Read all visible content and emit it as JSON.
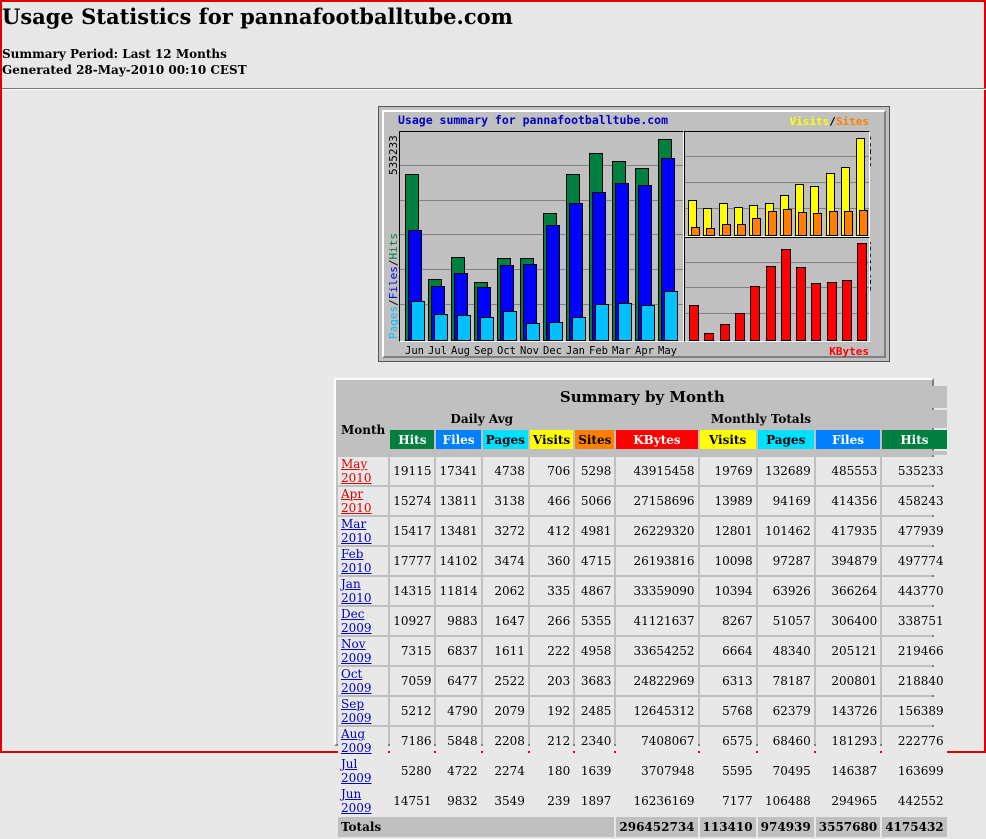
{
  "page": {
    "title": "Usage Statistics for pannafootballtube.com",
    "summary_period": "Summary Period: Last 12 Months",
    "generated": "Generated 28-May-2010 00:10 CEST"
  },
  "graph": {
    "title": "Usage summary for pannafootballtube.com",
    "legend_visits": "Visits",
    "legend_slash": "/",
    "legend_sites": "Sites",
    "legend_kbytes": "KBytes",
    "left_axis_pages": "Pages",
    "left_axis_files": "Files",
    "left_axis_hits": "Hits",
    "left_max": "535233",
    "right_top_max": "19769",
    "right_bottom_max": "43915458",
    "months": [
      "Jun",
      "Jul",
      "Aug",
      "Sep",
      "Oct",
      "Nov",
      "Dec",
      "Jan",
      "Feb",
      "Mar",
      "Apr",
      "May"
    ],
    "colors": {
      "hits": "#008040",
      "files": "#0000ff",
      "pages": "#00c0ff",
      "visits": "#ffff00",
      "sites": "#ff8000",
      "kbytes": "#ff0000"
    }
  },
  "table": {
    "caption": "Summary by Month",
    "month_header": "Month",
    "daily_avg": "Daily Avg",
    "monthly_totals": "Monthly Totals",
    "sub_daily": [
      "Hits",
      "Files",
      "Pages",
      "Visits"
    ],
    "sub_monthly": [
      "Sites",
      "KBytes",
      "Visits",
      "Pages",
      "Files",
      "Hits"
    ],
    "rows": [
      {
        "month": "May 2010",
        "hits_d": "19115",
        "files_d": "17341",
        "pages_d": "4738",
        "visits_d": "706",
        "sites": "5298",
        "kbytes": "43915458",
        "visits": "19769",
        "pages": "132689",
        "files": "485553",
        "hits": "535233"
      },
      {
        "month": "Apr 2010",
        "hits_d": "15274",
        "files_d": "13811",
        "pages_d": "3138",
        "visits_d": "466",
        "sites": "5066",
        "kbytes": "27158696",
        "visits": "13989",
        "pages": "94169",
        "files": "414356",
        "hits": "458243"
      },
      {
        "month": "Mar 2010",
        "hits_d": "15417",
        "files_d": "13481",
        "pages_d": "3272",
        "visits_d": "412",
        "sites": "4981",
        "kbytes": "26229320",
        "visits": "12801",
        "pages": "101462",
        "files": "417935",
        "hits": "477939"
      },
      {
        "month": "Feb 2010",
        "hits_d": "17777",
        "files_d": "14102",
        "pages_d": "3474",
        "visits_d": "360",
        "sites": "4715",
        "kbytes": "26193816",
        "visits": "10098",
        "pages": "97287",
        "files": "394879",
        "hits": "497774"
      },
      {
        "month": "Jan 2010",
        "hits_d": "14315",
        "files_d": "11814",
        "pages_d": "2062",
        "visits_d": "335",
        "sites": "4867",
        "kbytes": "33359090",
        "visits": "10394",
        "pages": "63926",
        "files": "366264",
        "hits": "443770"
      },
      {
        "month": "Dec 2009",
        "hits_d": "10927",
        "files_d": "9883",
        "pages_d": "1647",
        "visits_d": "266",
        "sites": "5355",
        "kbytes": "41121637",
        "visits": "8267",
        "pages": "51057",
        "files": "306400",
        "hits": "338751"
      },
      {
        "month": "Nov 2009",
        "hits_d": "7315",
        "files_d": "6837",
        "pages_d": "1611",
        "visits_d": "222",
        "sites": "4958",
        "kbytes": "33654252",
        "visits": "6664",
        "pages": "48340",
        "files": "205121",
        "hits": "219466"
      },
      {
        "month": "Oct 2009",
        "hits_d": "7059",
        "files_d": "6477",
        "pages_d": "2522",
        "visits_d": "203",
        "sites": "3683",
        "kbytes": "24822969",
        "visits": "6313",
        "pages": "78187",
        "files": "200801",
        "hits": "218840"
      },
      {
        "month": "Sep 2009",
        "hits_d": "5212",
        "files_d": "4790",
        "pages_d": "2079",
        "visits_d": "192",
        "sites": "2485",
        "kbytes": "12645312",
        "visits": "5768",
        "pages": "62379",
        "files": "143726",
        "hits": "156389"
      },
      {
        "month": "Aug 2009",
        "hits_d": "7186",
        "files_d": "5848",
        "pages_d": "2208",
        "visits_d": "212",
        "sites": "2340",
        "kbytes": "7408067",
        "visits": "6575",
        "pages": "68460",
        "files": "181293",
        "hits": "222776"
      },
      {
        "month": "Jul 2009",
        "hits_d": "5280",
        "files_d": "4722",
        "pages_d": "2274",
        "visits_d": "180",
        "sites": "1639",
        "kbytes": "3707948",
        "visits": "5595",
        "pages": "70495",
        "files": "146387",
        "hits": "163699"
      },
      {
        "month": "Jun 2009",
        "hits_d": "14751",
        "files_d": "9832",
        "pages_d": "3549",
        "visits_d": "239",
        "sites": "1897",
        "kbytes": "16236169",
        "visits": "7177",
        "pages": "106488",
        "files": "294965",
        "hits": "442552"
      }
    ],
    "totals": {
      "label": "Totals",
      "kbytes": "296452734",
      "visits": "113410",
      "pages": "974939",
      "files": "3557680",
      "hits": "4175432"
    }
  },
  "chart_data": {
    "type": "bar",
    "title": "Usage summary for pannafootballtube.com",
    "categories": [
      "Jun",
      "Jul",
      "Aug",
      "Sep",
      "Oct",
      "Nov",
      "Dec",
      "Jan",
      "Feb",
      "Mar",
      "Apr",
      "May"
    ],
    "series": [
      {
        "name": "Hits",
        "values": [
          442552,
          163699,
          222776,
          156389,
          218840,
          219466,
          338751,
          443770,
          497774,
          477939,
          458243,
          535233
        ]
      },
      {
        "name": "Files",
        "values": [
          294965,
          146387,
          181293,
          143726,
          200801,
          205121,
          306400,
          366264,
          394879,
          417935,
          414356,
          485553
        ]
      },
      {
        "name": "Pages",
        "values": [
          106488,
          70495,
          68460,
          62379,
          78187,
          48340,
          51057,
          63926,
          97287,
          101462,
          94169,
          132689
        ]
      },
      {
        "name": "Visits",
        "values": [
          7177,
          5595,
          6575,
          5768,
          6313,
          6664,
          8267,
          10394,
          10098,
          12801,
          13989,
          19769
        ]
      },
      {
        "name": "Sites",
        "values": [
          1897,
          1639,
          2340,
          2485,
          3683,
          4958,
          5355,
          4867,
          4715,
          4981,
          5066,
          5298
        ]
      },
      {
        "name": "KBytes",
        "values": [
          16236169,
          3707948,
          7408067,
          12645312,
          24822969,
          33654252,
          41121637,
          33359090,
          26193816,
          26229320,
          27158696,
          43915458
        ]
      }
    ],
    "ylim_left": [
      0,
      535233
    ],
    "ylim_right_top": [
      0,
      19769
    ],
    "ylim_right_bottom": [
      0,
      43915458
    ],
    "grid": true
  }
}
